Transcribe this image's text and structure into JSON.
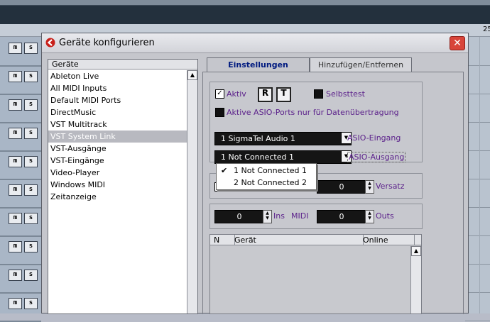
{
  "background": {
    "ruler_number": "25",
    "track_buttons": {
      "m": "m",
      "s": "s"
    }
  },
  "dialog": {
    "title": "Geräte konfigurieren",
    "close_label": "✕",
    "device_list": {
      "header": "Geräte",
      "items": [
        "Ableton Live",
        "All MIDI Inputs",
        "Default MIDI Ports",
        "DirectMusic",
        "VST Multitrack",
        "VST System Link",
        "VST-Ausgänge",
        "VST-Eingänge",
        "Video-Player",
        "Windows MIDI",
        "Zeitanzeige"
      ],
      "selected": "VST System Link"
    },
    "tabs": [
      {
        "label": "Einstellungen",
        "active": true
      },
      {
        "label": "Hinzufügen/Entfernen",
        "active": false
      }
    ],
    "settings": {
      "aktiv_label": "Aktiv",
      "aktiv_checked": true,
      "r_button": "R",
      "t_button": "T",
      "selbsttest_label": "Selbsttest",
      "asio_only_label": "Aktive ASIO-Ports nur für Datenübertragung",
      "asio_input_value": "1 SigmaTel Audio 1",
      "asio_input_label": "ASIO-Eingang",
      "asio_output_value": "1 Not Connected 1",
      "asio_output_label": "ASIO-Ausgang",
      "dropdown_options": [
        "1 Not Connected 1",
        "2 Not Connected 2"
      ],
      "dropdown_selected": "1 Not Connected 1",
      "versatz_value": "0",
      "versatz_label": "Versatz",
      "ins_value": "0",
      "ins_label": "Ins",
      "midi_label": "MIDI",
      "outs_value": "0",
      "outs_label": "Outs"
    },
    "table": {
      "columns": [
        "N",
        "Gerät",
        "Online"
      ]
    }
  },
  "colors": {
    "accent_label": "#5a1f8a",
    "close_button": "#d8453a",
    "selection": "#b8b9c0"
  }
}
